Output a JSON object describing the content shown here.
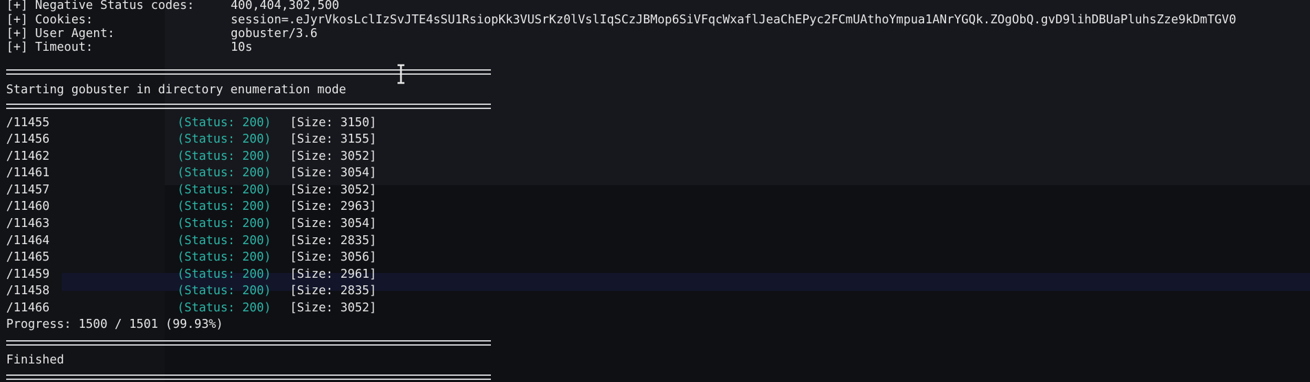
{
  "header": [
    {
      "label": "[+] Negative Status codes:",
      "value": "400,404,302,500"
    },
    {
      "label": "[+] Cookies:",
      "value": "session=.eJyrVkosLclIzSvJTE4sSU1RsiopKk3VUSrKz0lVslIqSCzJBMop6SiVFqcWxaflJeaChEPyc2FCmUAthoYmpua1ANrYGQk.ZOgObQ.gvD9lihDBUaPluhsZze9kDmTGV0"
    },
    {
      "label": "[+] User Agent:",
      "value": "gobuster/3.6"
    },
    {
      "label": "[+] Timeout:",
      "value": "10s"
    }
  ],
  "start_message": "Starting gobuster in directory enumeration mode",
  "results": [
    {
      "path": "/11455",
      "status": "(Status: 200)",
      "size": "[Size: 3150]"
    },
    {
      "path": "/11456",
      "status": "(Status: 200)",
      "size": "[Size: 3155]"
    },
    {
      "path": "/11462",
      "status": "(Status: 200)",
      "size": "[Size: 3052]"
    },
    {
      "path": "/11461",
      "status": "(Status: 200)",
      "size": "[Size: 3054]"
    },
    {
      "path": "/11457",
      "status": "(Status: 200)",
      "size": "[Size: 3052]"
    },
    {
      "path": "/11460",
      "status": "(Status: 200)",
      "size": "[Size: 2963]"
    },
    {
      "path": "/11463",
      "status": "(Status: 200)",
      "size": "[Size: 3054]"
    },
    {
      "path": "/11464",
      "status": "(Status: 200)",
      "size": "[Size: 2835]"
    },
    {
      "path": "/11465",
      "status": "(Status: 200)",
      "size": "[Size: 3056]"
    },
    {
      "path": "/11459",
      "status": "(Status: 200)",
      "size": "[Size: 2961]"
    },
    {
      "path": "/11458",
      "status": "(Status: 200)",
      "size": "[Size: 2835]"
    },
    {
      "path": "/11466",
      "status": "(Status: 200)",
      "size": "[Size: 3052]"
    }
  ],
  "progress": "Progress: 1500 / 1501 (99.93%)",
  "finished": "Finished",
  "colors": {
    "background": "#121317",
    "text": "#e6e6e6",
    "status": "#2bb5a6"
  },
  "icons": {
    "cursor": "text-cursor-icon"
  }
}
